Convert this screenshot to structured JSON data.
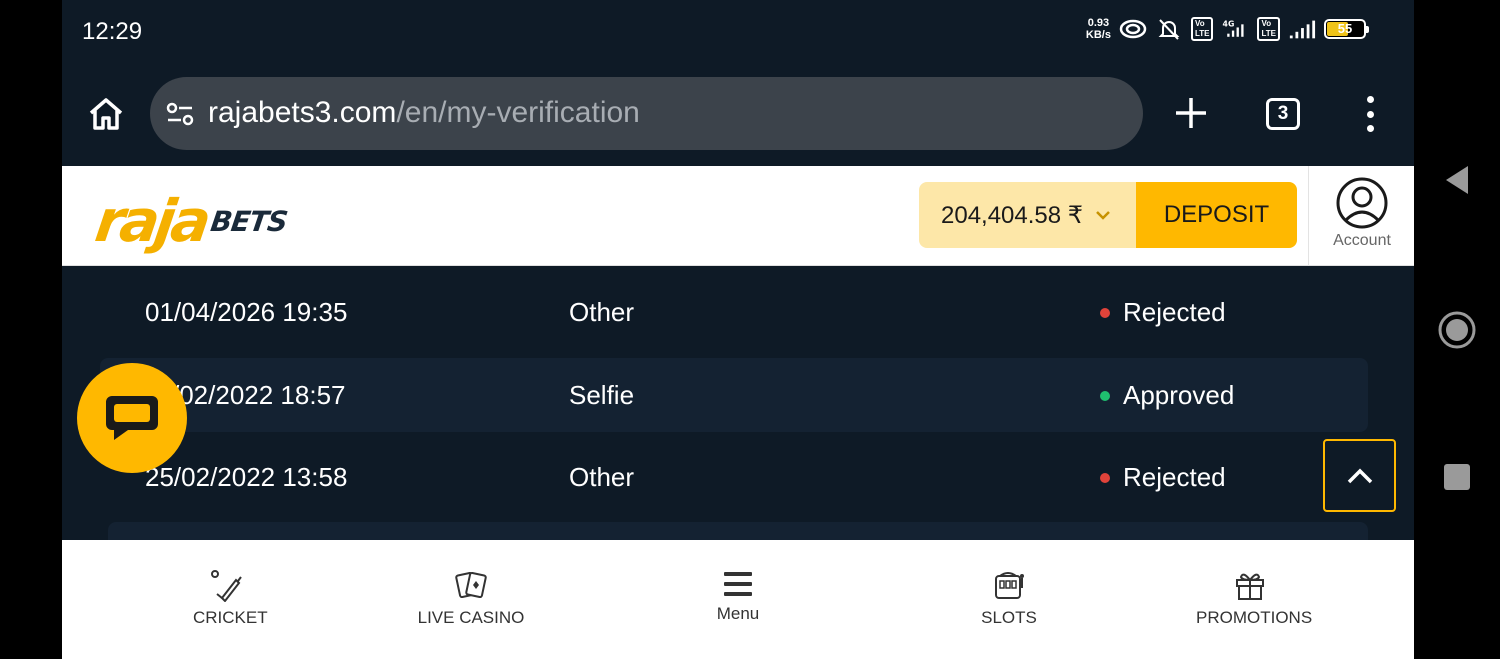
{
  "status_bar": {
    "time": "12:29",
    "net_speed_value": "0.93",
    "net_speed_unit": "KB/s",
    "network": "4G",
    "battery": "55"
  },
  "browser": {
    "url_domain": "rajabets3.com",
    "url_path": "/en/my-verification",
    "tab_count": "3"
  },
  "header": {
    "logo_raja": "raja",
    "logo_bets": "BETS",
    "balance": "204,404.58 ₹",
    "deposit_label": "DEPOSIT",
    "account_label": "Account"
  },
  "verification_rows": [
    {
      "date": "01/04/2026 19:35",
      "type": "Other",
      "status": "Rejected",
      "status_color": "#e0433a"
    },
    {
      "date": "/02/2022 18:57",
      "type": "Selfie",
      "status": "Approved",
      "status_color": "#1fbf6f"
    },
    {
      "date": "25/02/2022 13:58",
      "type": "Other",
      "status": "Rejected",
      "status_color": "#e0433a"
    }
  ],
  "bottom_nav": {
    "cricket": "CRICKET",
    "live_casino": "LIVE CASINO",
    "menu": "Menu",
    "slots": "SLOTS",
    "promotions": "PROMOTIONS"
  },
  "colors": {
    "accent": "#ffb800",
    "background": "#0e1a26",
    "rejected": "#e0433a",
    "approved": "#1fbf6f"
  }
}
